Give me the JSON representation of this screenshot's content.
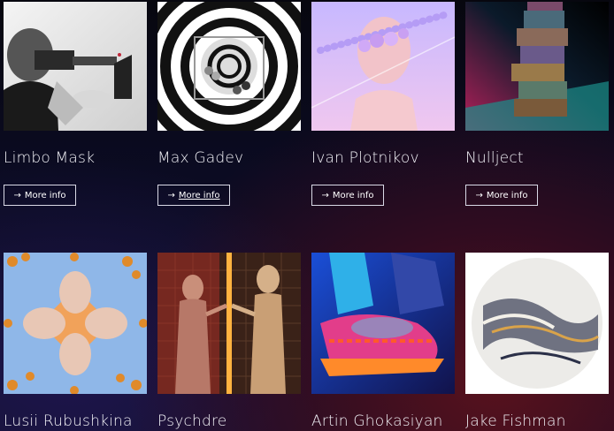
{
  "artists": [
    {
      "name": "Limbo Mask",
      "button": "More info",
      "arrow": "→",
      "hovered": false
    },
    {
      "name": "Max Gadev",
      "button": "More info",
      "arrow": "→",
      "hovered": true
    },
    {
      "name": "Ivan Plotnikov",
      "button": "More info",
      "arrow": "→",
      "hovered": false
    },
    {
      "name": "Nullject",
      "button": "More info",
      "arrow": "→",
      "hovered": false
    },
    {
      "name": "Lusii Rubushkina"
    },
    {
      "name": "Psychdre"
    },
    {
      "name": "Artin Ghokasiyan"
    },
    {
      "name": "Jake Fishman"
    }
  ],
  "colors": {
    "background_top": "#07070f",
    "background_bottom_right": "#5c121c",
    "text": "#f2f2f7",
    "button_border": "#d9d9e6"
  }
}
